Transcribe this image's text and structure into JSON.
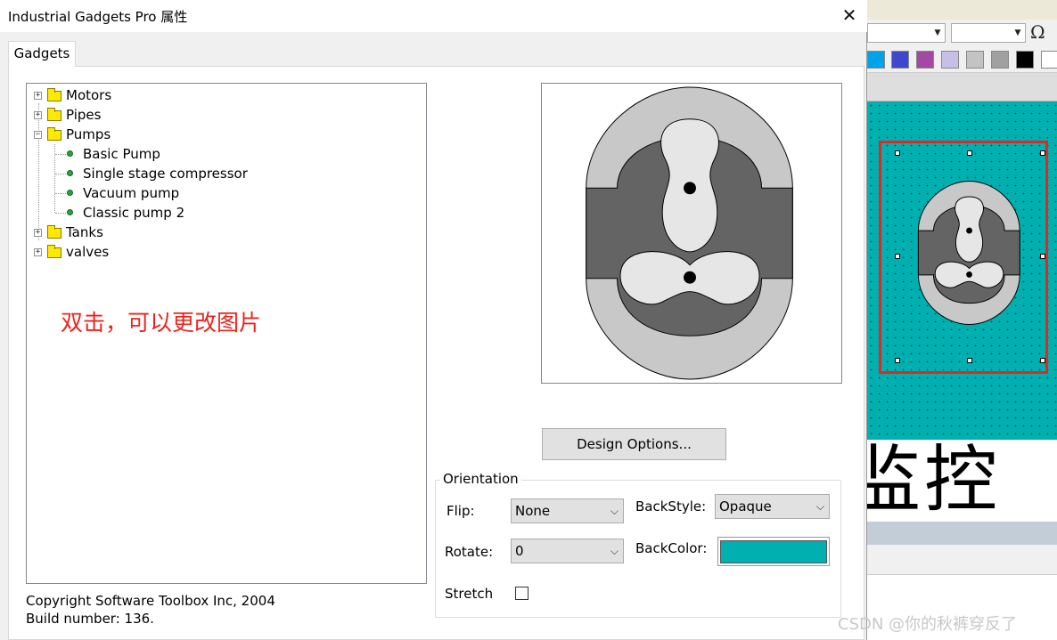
{
  "dialog": {
    "title": "Industrial Gadgets Pro 属性",
    "close_label": "✕",
    "tab_label": "Gadgets"
  },
  "tree": {
    "items": [
      {
        "label": "Motors",
        "expander": "+"
      },
      {
        "label": "Pipes",
        "expander": "+"
      },
      {
        "label": "Pumps",
        "expander": "−"
      },
      {
        "label": "Basic Pump"
      },
      {
        "label": "Single stage compressor"
      },
      {
        "label": "Vacuum pump"
      },
      {
        "label": "Classic pump 2"
      },
      {
        "label": "Tanks",
        "expander": "+"
      },
      {
        "label": "valves",
        "expander": "+"
      }
    ]
  },
  "annotation": "双击，可以更改图片",
  "footer": {
    "copyright": "Copyright Software Toolbox Inc, 2004",
    "build": "Build number: 136."
  },
  "design_options_label": "Design Options...",
  "orientation": {
    "group_label": "Orientation",
    "flip_label": "Flip:",
    "flip_value": "None",
    "rotate_label": "Rotate:",
    "rotate_value": "0",
    "backstyle_label": "BackStyle:",
    "backstyle_value": "Opaque",
    "backcolor_label": "BackColor:",
    "backcolor_value": "#00b0b0",
    "stretch_label": "Stretch",
    "stretch_checked": false
  },
  "background_app": {
    "omega_glyph": "Ω",
    "large_text": "监控",
    "swatch_colors": [
      "#00a2e8",
      "#3f48cc",
      "#a349a4",
      "#c8bfe7",
      "#c3c3c3",
      "#a0a0a0",
      "#000000"
    ]
  },
  "watermark": "CSDN @你的秋裤穿反了",
  "colors": {
    "pump_outer": "#c8c8c8",
    "pump_body": "#646464",
    "pump_lobe": "#e6e6e6",
    "canvas_teal": "#00b0b0",
    "selection_red": "#e8251f"
  }
}
